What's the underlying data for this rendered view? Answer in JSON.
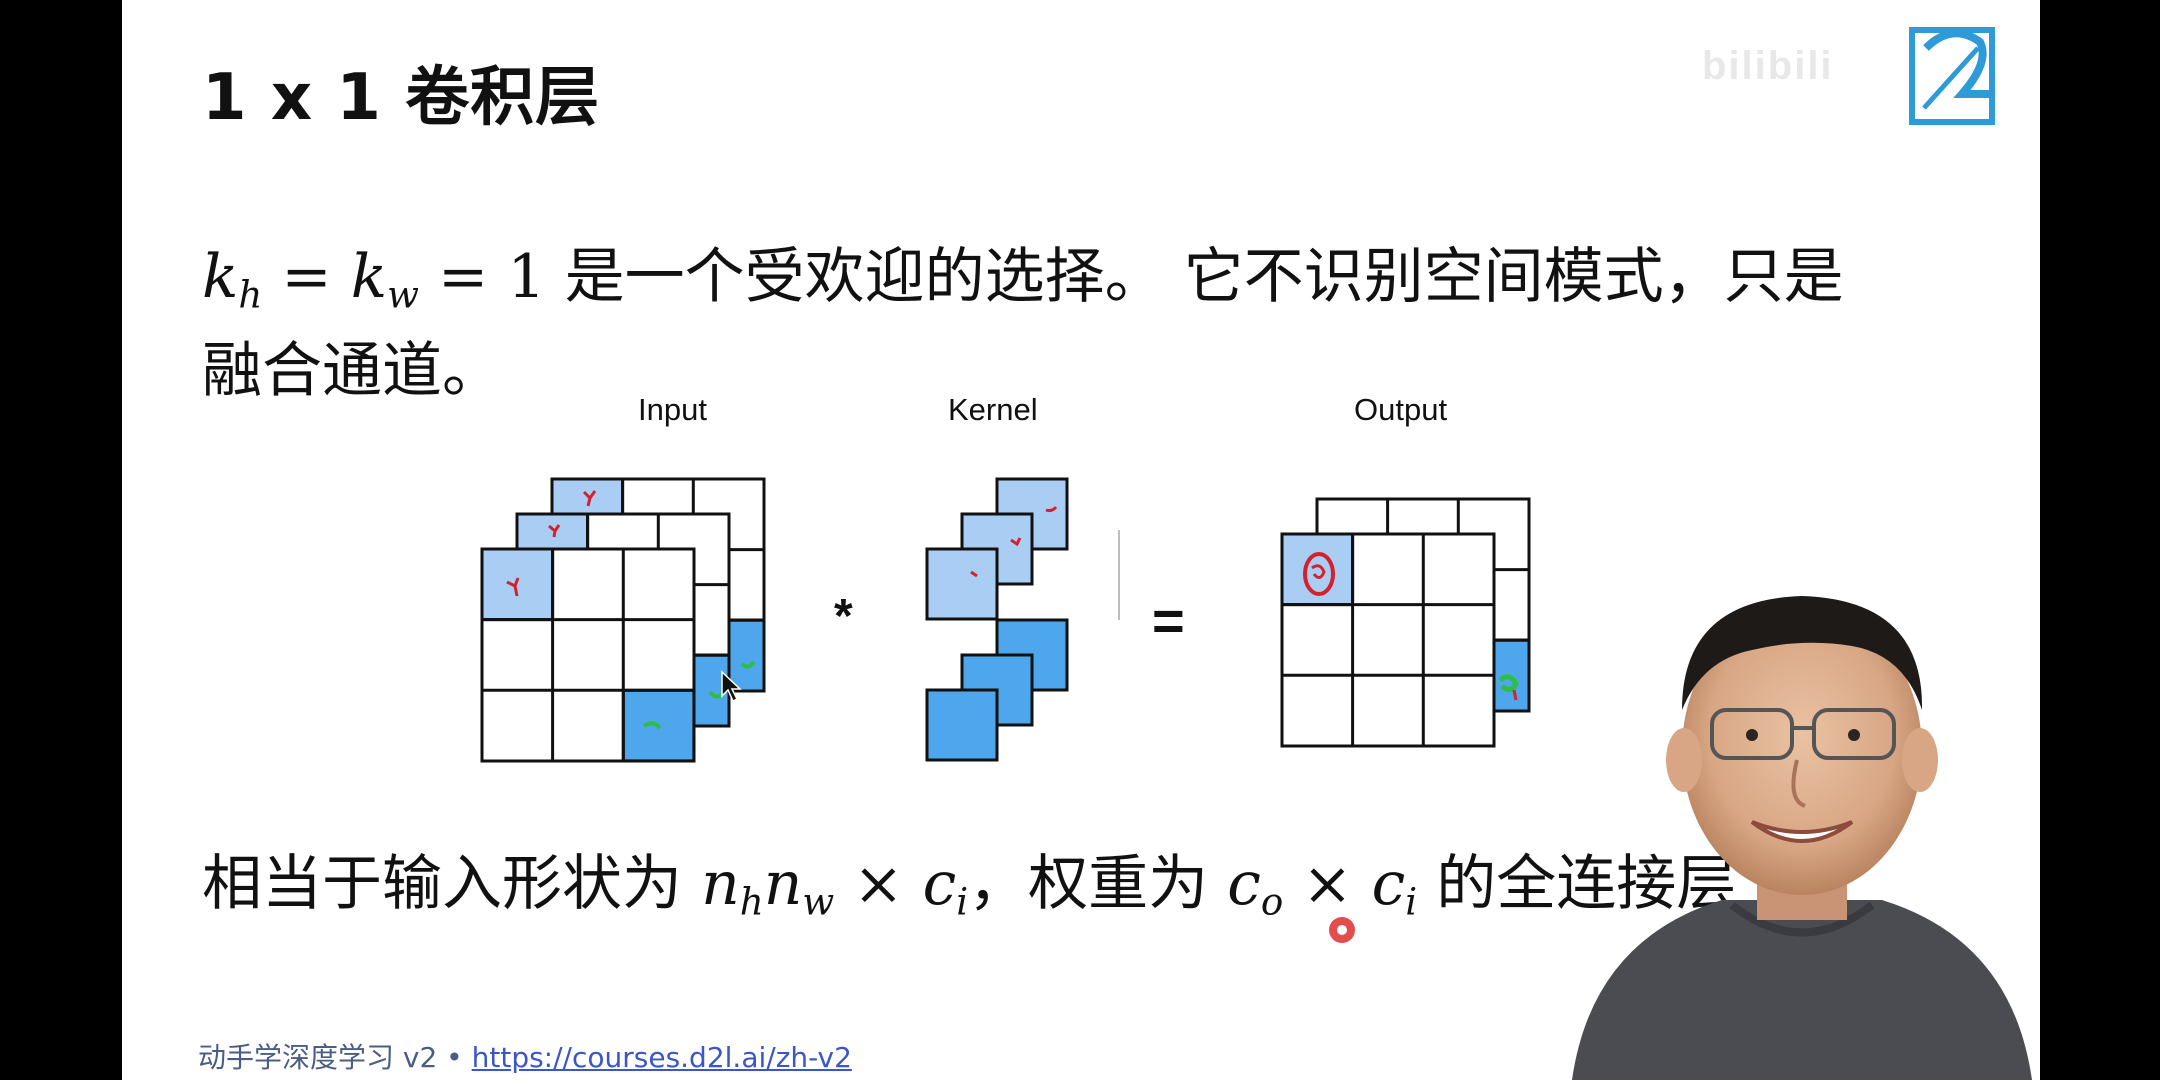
{
  "slide": {
    "title": "1 x 1 卷积层",
    "line1_pre": "",
    "line1_text": " 是一个受欢迎的选择。 它不识别空间模式，只是",
    "line2_text": "融合通道。",
    "math1": {
      "kh": "k",
      "kh_sub": "h",
      "eq1": " = ",
      "kw": "k",
      "kw_sub": "w",
      "eq2": " = 1"
    },
    "line3_text_a": "相当于输入形状为 ",
    "math3": {
      "nh": "n",
      "nh_sub": "h",
      "nw": "n",
      "nw_sub": "w",
      "times": " × ",
      "ci": "c",
      "ci_sub": "i",
      "co": "c",
      "co_sub": "o",
      "times2": " × ",
      "ci2": "c",
      "ci2_sub": "i"
    },
    "line3_text_b": "，权重为 ",
    "line3_text_c": " 的全连接层"
  },
  "diagram": {
    "input_label": "Input",
    "kernel_label": "Kernel",
    "output_label": "Output",
    "op_multiply": "*",
    "op_equals": "=",
    "colors": {
      "light_blue": "#a9cdf3",
      "blue": "#4ea6ec",
      "border": "#111111",
      "ink_red": "#d4222c",
      "ink_green": "#2fbd44"
    }
  },
  "footer": {
    "course": "动手学深度学习 v2 • ",
    "link": "https://courses.d2l.ai/zh-v2"
  },
  "overlay": {
    "logo": "bilibili-logo-icon",
    "watermark": "bilibili-watermark",
    "presenter": "presenter-webcam",
    "laser": "laser-pointer-icon"
  }
}
